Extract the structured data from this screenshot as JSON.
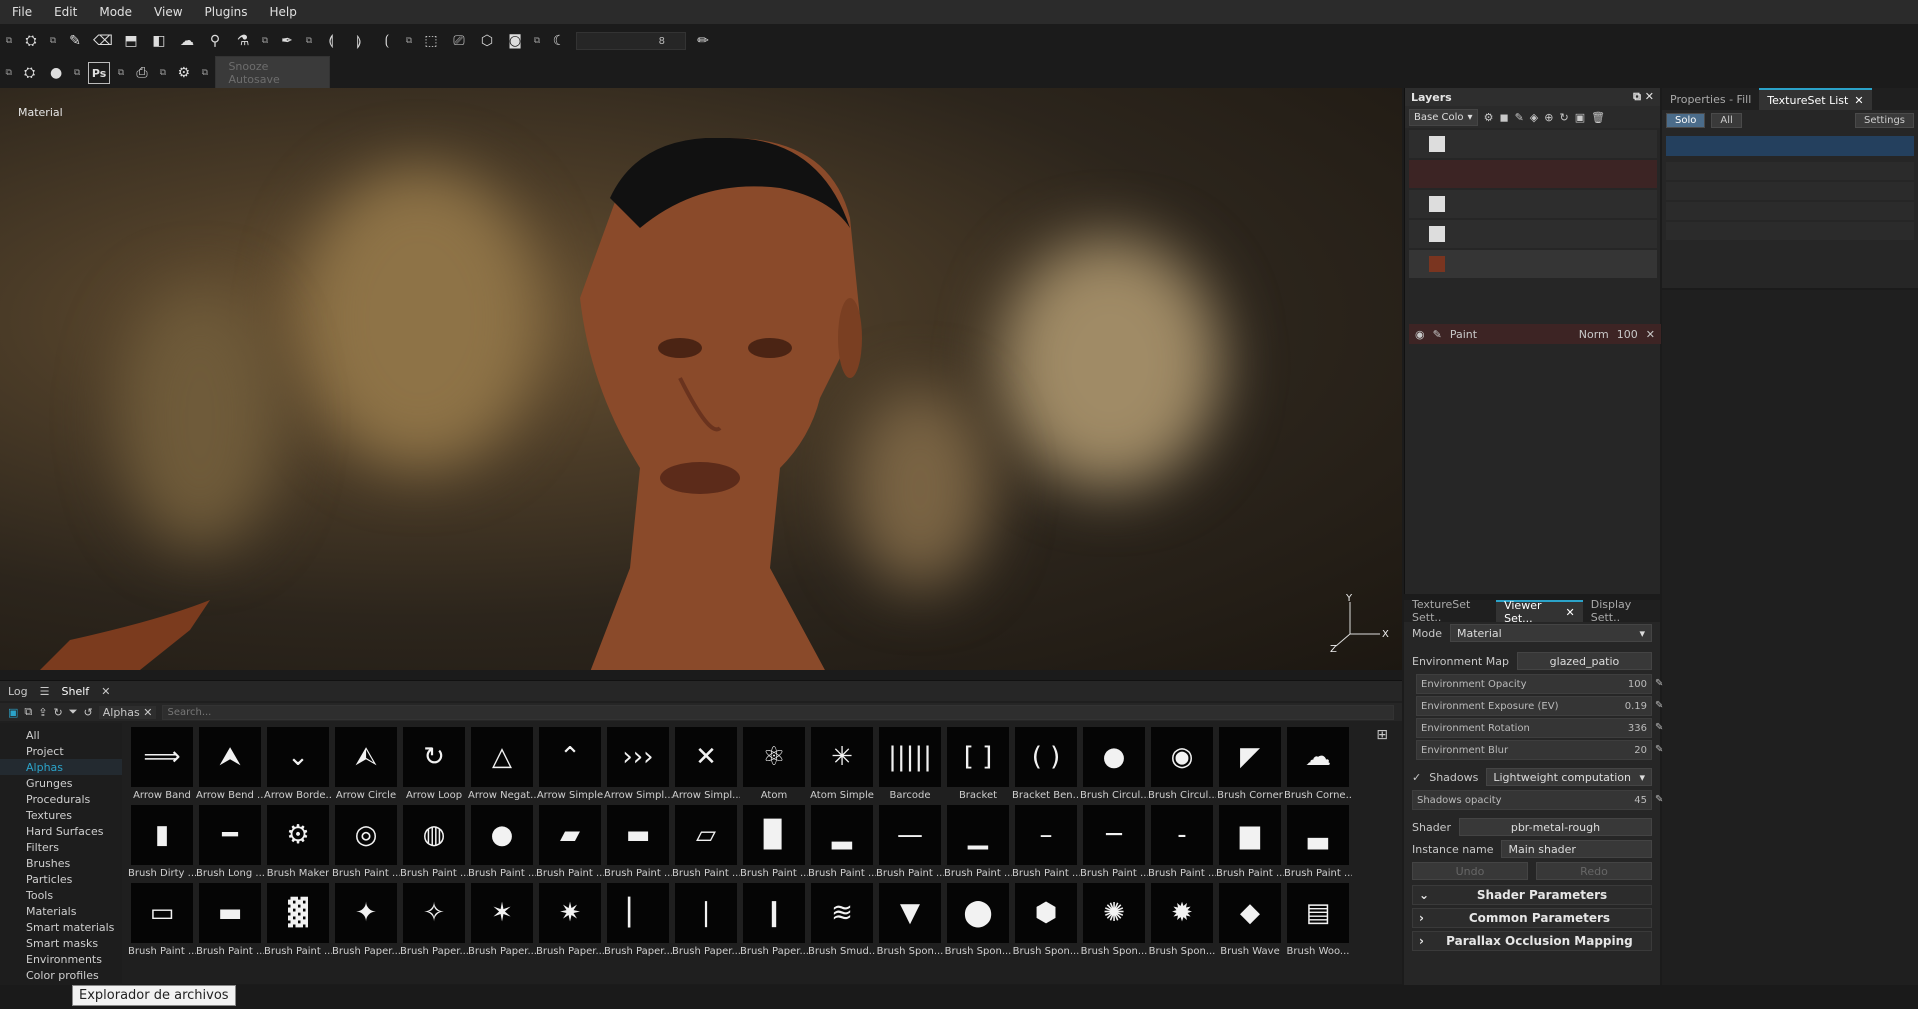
{
  "menu": [
    "File",
    "Edit",
    "Mode",
    "View",
    "Plugins",
    "Help"
  ],
  "toolbar": {
    "brush_size_value": "8",
    "snooze_label": "Snooze Autosave",
    "ps_label": "Ps"
  },
  "viewport": {
    "label": "Material",
    "axis_y": "Y",
    "axis_x": "X",
    "axis_z": "Z"
  },
  "layers": {
    "title": "Layers",
    "channel_dropdown": "Base Colo",
    "paint_layer": {
      "name": "Paint",
      "blend": "Norm",
      "opacity": "100"
    }
  },
  "properties": {
    "tabs": [
      "Properties - Fill",
      "TextureSet List"
    ],
    "solo": "Solo",
    "all": "All",
    "settings": "Settings"
  },
  "viewer": {
    "tabs": [
      "TextureSet Sett..",
      "Viewer Set...",
      "Display Sett.."
    ],
    "mode_label": "Mode",
    "mode_value": "Material",
    "env_map_label": "Environment Map",
    "env_map_value": "glazed_patio",
    "sliders": [
      {
        "label": "Environment Opacity",
        "value": "100"
      },
      {
        "label": "Environment Exposure (EV)",
        "value": "0.19"
      },
      {
        "label": "Environment Rotation",
        "value": "336"
      },
      {
        "label": "Environment Blur",
        "value": "20"
      }
    ],
    "shadows_label": "Shadows",
    "shadows_mode": "Lightweight computation",
    "shadows_opacity_label": "Shadows opacity",
    "shadows_opacity_value": "45",
    "shader_label": "Shader",
    "shader_value": "pbr-metal-rough",
    "instance_label": "Instance name",
    "instance_value": "Main shader",
    "undo": "Undo",
    "redo": "Redo",
    "sections": [
      "Shader Parameters",
      "Common Parameters",
      "Parallax Occlusion Mapping"
    ]
  },
  "shelf": {
    "tabs": [
      "Log",
      "Shelf"
    ],
    "filter_tag": "Alphas",
    "search_placeholder": "Search...",
    "categories": [
      "All",
      "Project",
      "Alphas",
      "Grunges",
      "Procedurals",
      "Textures",
      "Hard Surfaces",
      "Filters",
      "Brushes",
      "Particles",
      "Tools",
      "Materials",
      "Smart materials",
      "Smart masks",
      "Environments",
      "Color profiles"
    ],
    "selected_category": "Alphas",
    "items": [
      {
        "label": "Arrow Band",
        "glyph": "⟹"
      },
      {
        "label": "Arrow Bend ...",
        "glyph": "⮝"
      },
      {
        "label": "Arrow Borde...",
        "glyph": "⌄"
      },
      {
        "label": "Arrow Circle",
        "glyph": "⮙"
      },
      {
        "label": "Arrow Loop",
        "glyph": "↻"
      },
      {
        "label": "Arrow Negat...",
        "glyph": "△"
      },
      {
        "label": "Arrow Simple",
        "glyph": "⌃"
      },
      {
        "label": "Arrow Simpl...",
        "glyph": "›››"
      },
      {
        "label": "Arrow Simpl...",
        "glyph": "✕"
      },
      {
        "label": "Atom",
        "glyph": "⚛"
      },
      {
        "label": "Atom Simple",
        "glyph": "✳"
      },
      {
        "label": "Barcode",
        "glyph": "|||||"
      },
      {
        "label": "Bracket",
        "glyph": "[ ]"
      },
      {
        "label": "Bracket Ben...",
        "glyph": "( )"
      },
      {
        "label": "Brush Circul...",
        "glyph": "●"
      },
      {
        "label": "Brush Circul...",
        "glyph": "◉"
      },
      {
        "label": "Brush Corner",
        "glyph": "◤"
      },
      {
        "label": "Brush Corne...",
        "glyph": "☁"
      },
      {
        "label": "Brush Dirty ...",
        "glyph": "▮"
      },
      {
        "label": "Brush Long ...",
        "glyph": "━"
      },
      {
        "label": "Brush Maker",
        "glyph": "⚙"
      },
      {
        "label": "Brush Paint ...",
        "glyph": "◎"
      },
      {
        "label": "Brush Paint ...",
        "glyph": "◍"
      },
      {
        "label": "Brush Paint ...",
        "glyph": "●"
      },
      {
        "label": "Brush Paint ...",
        "glyph": "▰"
      },
      {
        "label": "Brush Paint ...",
        "glyph": "▬"
      },
      {
        "label": "Brush Paint ...",
        "glyph": "▱"
      },
      {
        "label": "Brush Paint ...",
        "glyph": "▉"
      },
      {
        "label": "Brush Paint ...",
        "glyph": "▂"
      },
      {
        "label": "Brush Paint ...",
        "glyph": "—"
      },
      {
        "label": "Brush Paint ...",
        "glyph": "▁"
      },
      {
        "label": "Brush Paint ...",
        "glyph": "–"
      },
      {
        "label": "Brush Paint ...",
        "glyph": "─"
      },
      {
        "label": "Brush Paint ...",
        "glyph": "-"
      },
      {
        "label": "Brush Paint ...",
        "glyph": "▆"
      },
      {
        "label": "Brush Paint ...",
        "glyph": "▃"
      },
      {
        "label": "Brush Paint ...",
        "glyph": "▭"
      },
      {
        "label": "Brush Paint ...",
        "glyph": "▬"
      },
      {
        "label": "Brush Paint ...",
        "glyph": "▓"
      },
      {
        "label": "Brush Paper...",
        "glyph": "✦"
      },
      {
        "label": "Brush Paper...",
        "glyph": "✧"
      },
      {
        "label": "Brush Paper...",
        "glyph": "✶"
      },
      {
        "label": "Brush Paper...",
        "glyph": "✷"
      },
      {
        "label": "Brush Paper...",
        "glyph": "▏"
      },
      {
        "label": "Brush Paper...",
        "glyph": "❘"
      },
      {
        "label": "Brush Paper...",
        "glyph": "❙"
      },
      {
        "label": "Brush Smud...",
        "glyph": "≋"
      },
      {
        "label": "Brush Spon...",
        "glyph": "▼"
      },
      {
        "label": "Brush Spon...",
        "glyph": "⬤"
      },
      {
        "label": "Brush Spon...",
        "glyph": "⬢"
      },
      {
        "label": "Brush Spon...",
        "glyph": "✺"
      },
      {
        "label": "Brush Spon...",
        "glyph": "✹"
      },
      {
        "label": "Brush Wave",
        "glyph": "◆"
      },
      {
        "label": "Brush Woo...",
        "glyph": "▤"
      }
    ]
  },
  "tooltip": "Explorador de archivos"
}
